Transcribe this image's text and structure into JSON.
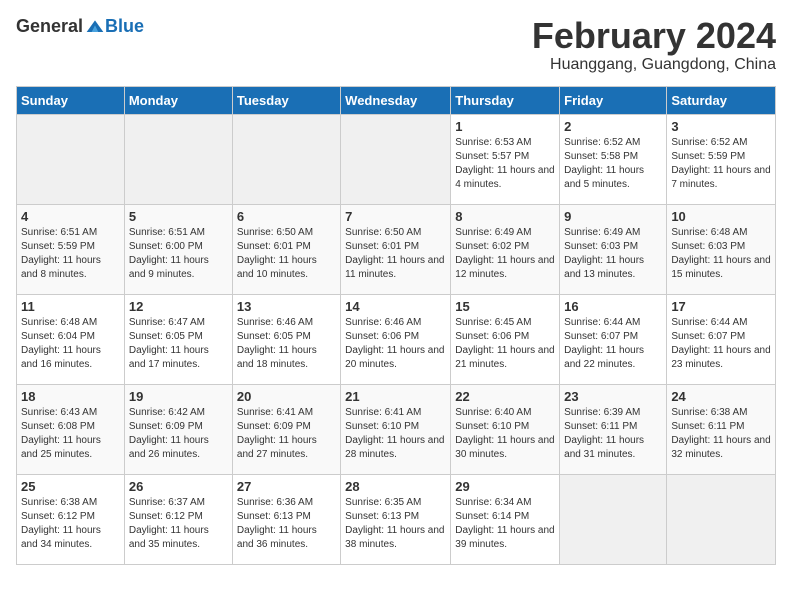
{
  "header": {
    "logo": {
      "text_general": "General",
      "text_blue": "Blue"
    },
    "title": "February 2024",
    "location": "Huanggang, Guangdong, China"
  },
  "calendar": {
    "days_of_week": [
      "Sunday",
      "Monday",
      "Tuesday",
      "Wednesday",
      "Thursday",
      "Friday",
      "Saturday"
    ],
    "weeks": [
      [
        {
          "day": "",
          "info": ""
        },
        {
          "day": "",
          "info": ""
        },
        {
          "day": "",
          "info": ""
        },
        {
          "day": "",
          "info": ""
        },
        {
          "day": "1",
          "info": "Sunrise: 6:53 AM\nSunset: 5:57 PM\nDaylight: 11 hours and 4 minutes."
        },
        {
          "day": "2",
          "info": "Sunrise: 6:52 AM\nSunset: 5:58 PM\nDaylight: 11 hours and 5 minutes."
        },
        {
          "day": "3",
          "info": "Sunrise: 6:52 AM\nSunset: 5:59 PM\nDaylight: 11 hours and 7 minutes."
        }
      ],
      [
        {
          "day": "4",
          "info": "Sunrise: 6:51 AM\nSunset: 5:59 PM\nDaylight: 11 hours and 8 minutes."
        },
        {
          "day": "5",
          "info": "Sunrise: 6:51 AM\nSunset: 6:00 PM\nDaylight: 11 hours and 9 minutes."
        },
        {
          "day": "6",
          "info": "Sunrise: 6:50 AM\nSunset: 6:01 PM\nDaylight: 11 hours and 10 minutes."
        },
        {
          "day": "7",
          "info": "Sunrise: 6:50 AM\nSunset: 6:01 PM\nDaylight: 11 hours and 11 minutes."
        },
        {
          "day": "8",
          "info": "Sunrise: 6:49 AM\nSunset: 6:02 PM\nDaylight: 11 hours and 12 minutes."
        },
        {
          "day": "9",
          "info": "Sunrise: 6:49 AM\nSunset: 6:03 PM\nDaylight: 11 hours and 13 minutes."
        },
        {
          "day": "10",
          "info": "Sunrise: 6:48 AM\nSunset: 6:03 PM\nDaylight: 11 hours and 15 minutes."
        }
      ],
      [
        {
          "day": "11",
          "info": "Sunrise: 6:48 AM\nSunset: 6:04 PM\nDaylight: 11 hours and 16 minutes."
        },
        {
          "day": "12",
          "info": "Sunrise: 6:47 AM\nSunset: 6:05 PM\nDaylight: 11 hours and 17 minutes."
        },
        {
          "day": "13",
          "info": "Sunrise: 6:46 AM\nSunset: 6:05 PM\nDaylight: 11 hours and 18 minutes."
        },
        {
          "day": "14",
          "info": "Sunrise: 6:46 AM\nSunset: 6:06 PM\nDaylight: 11 hours and 20 minutes."
        },
        {
          "day": "15",
          "info": "Sunrise: 6:45 AM\nSunset: 6:06 PM\nDaylight: 11 hours and 21 minutes."
        },
        {
          "day": "16",
          "info": "Sunrise: 6:44 AM\nSunset: 6:07 PM\nDaylight: 11 hours and 22 minutes."
        },
        {
          "day": "17",
          "info": "Sunrise: 6:44 AM\nSunset: 6:07 PM\nDaylight: 11 hours and 23 minutes."
        }
      ],
      [
        {
          "day": "18",
          "info": "Sunrise: 6:43 AM\nSunset: 6:08 PM\nDaylight: 11 hours and 25 minutes."
        },
        {
          "day": "19",
          "info": "Sunrise: 6:42 AM\nSunset: 6:09 PM\nDaylight: 11 hours and 26 minutes."
        },
        {
          "day": "20",
          "info": "Sunrise: 6:41 AM\nSunset: 6:09 PM\nDaylight: 11 hours and 27 minutes."
        },
        {
          "day": "21",
          "info": "Sunrise: 6:41 AM\nSunset: 6:10 PM\nDaylight: 11 hours and 28 minutes."
        },
        {
          "day": "22",
          "info": "Sunrise: 6:40 AM\nSunset: 6:10 PM\nDaylight: 11 hours and 30 minutes."
        },
        {
          "day": "23",
          "info": "Sunrise: 6:39 AM\nSunset: 6:11 PM\nDaylight: 11 hours and 31 minutes."
        },
        {
          "day": "24",
          "info": "Sunrise: 6:38 AM\nSunset: 6:11 PM\nDaylight: 11 hours and 32 minutes."
        }
      ],
      [
        {
          "day": "25",
          "info": "Sunrise: 6:38 AM\nSunset: 6:12 PM\nDaylight: 11 hours and 34 minutes."
        },
        {
          "day": "26",
          "info": "Sunrise: 6:37 AM\nSunset: 6:12 PM\nDaylight: 11 hours and 35 minutes."
        },
        {
          "day": "27",
          "info": "Sunrise: 6:36 AM\nSunset: 6:13 PM\nDaylight: 11 hours and 36 minutes."
        },
        {
          "day": "28",
          "info": "Sunrise: 6:35 AM\nSunset: 6:13 PM\nDaylight: 11 hours and 38 minutes."
        },
        {
          "day": "29",
          "info": "Sunrise: 6:34 AM\nSunset: 6:14 PM\nDaylight: 11 hours and 39 minutes."
        },
        {
          "day": "",
          "info": ""
        },
        {
          "day": "",
          "info": ""
        }
      ]
    ]
  }
}
